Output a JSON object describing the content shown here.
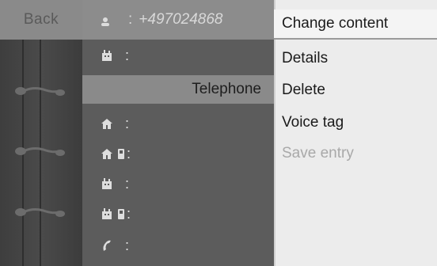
{
  "topbar": {
    "back_label": "Back",
    "person_icon": "person-icon",
    "colon": ":",
    "number": "+497024868"
  },
  "list": {
    "rows": [
      {
        "icon": "office-icon",
        "colon": ":"
      },
      {
        "label": "Telephone"
      },
      {
        "icon": "home-icon",
        "colon": ":"
      },
      {
        "icon": "home-mobile-icon",
        "colon": ":"
      },
      {
        "icon": "office-icon",
        "colon": ":"
      },
      {
        "icon": "office-mobile-icon",
        "colon": ":"
      },
      {
        "icon": "phone-handset-icon",
        "colon": ":"
      }
    ]
  },
  "menu": {
    "items": [
      {
        "label": "Change content"
      },
      {
        "label": "Details"
      },
      {
        "label": "Delete"
      },
      {
        "label": "Voice tag"
      },
      {
        "label": "Save entry"
      }
    ]
  },
  "colors": {
    "menu_bg": "#ececec",
    "list_bg": "#5c5c5c",
    "selected_row": "#8a8a8a",
    "disabled_text": "#a9a9a9"
  }
}
